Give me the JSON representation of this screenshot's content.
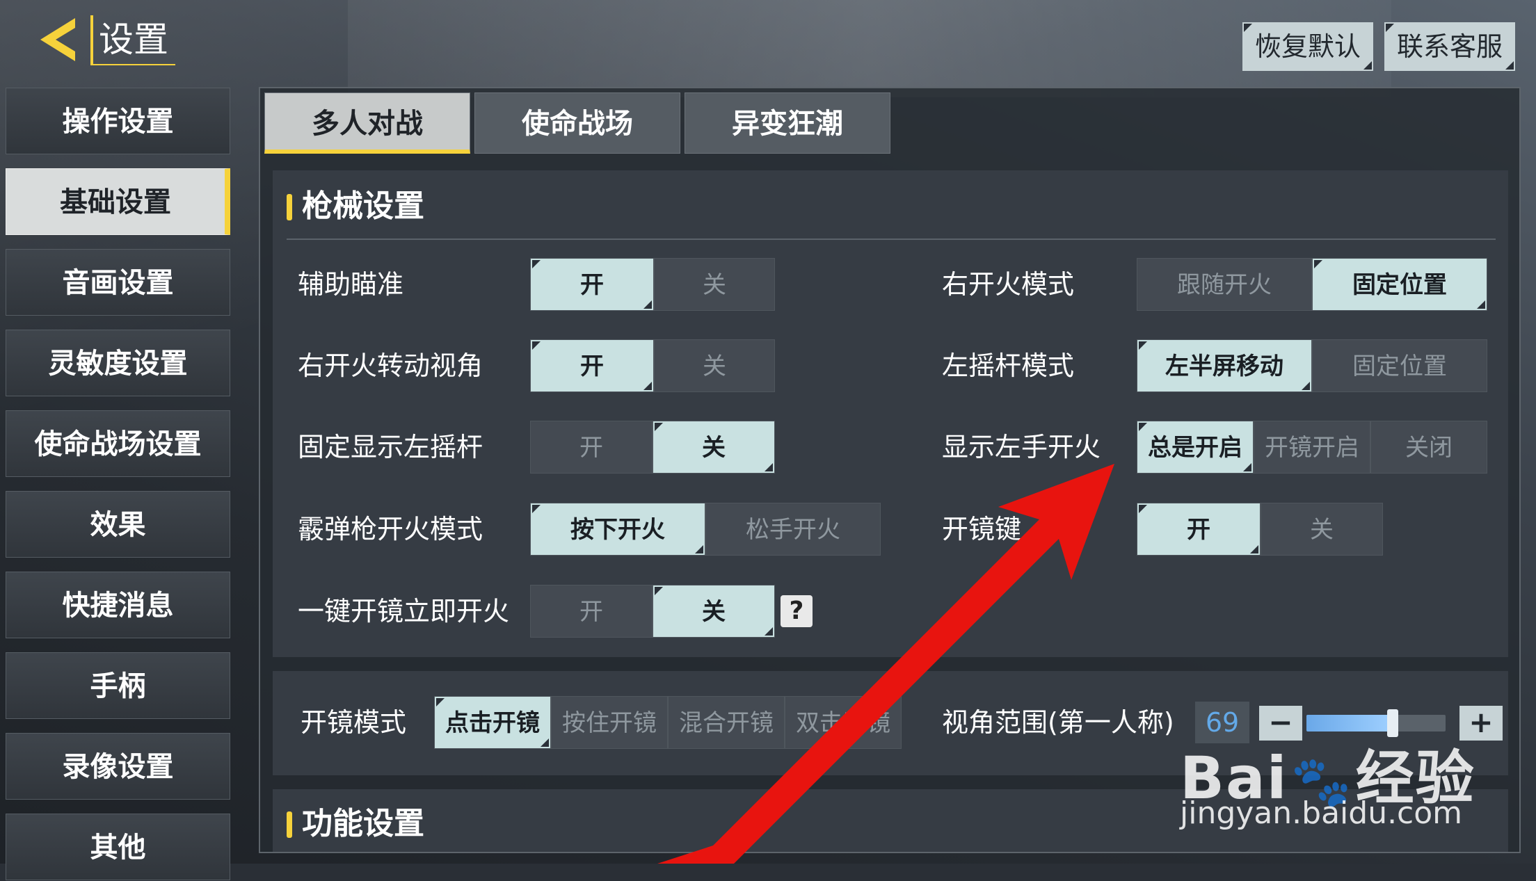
{
  "header": {
    "title": "设置",
    "restore_default": "恢复默认",
    "contact_service": "联系客服"
  },
  "sidebar": {
    "items": [
      {
        "label": "操作设置"
      },
      {
        "label": "基础设置"
      },
      {
        "label": "音画设置"
      },
      {
        "label": "灵敏度设置"
      },
      {
        "label": "使命战场设置"
      },
      {
        "label": "效果"
      },
      {
        "label": "快捷消息"
      },
      {
        "label": "手柄"
      },
      {
        "label": "录像设置"
      },
      {
        "label": "其他"
      }
    ],
    "active_index": 1
  },
  "tabs": [
    {
      "label": "多人对战"
    },
    {
      "label": "使命战场"
    },
    {
      "label": "异变狂潮"
    }
  ],
  "weapon": {
    "heading": "枪械设置",
    "aim_assist": {
      "label": "辅助瞄准",
      "on": "开",
      "off": "关"
    },
    "right_fire_rotate": {
      "label": "右开火转动视角",
      "on": "开",
      "off": "关"
    },
    "fixed_left_stick": {
      "label": "固定显示左摇杆",
      "on": "开",
      "off": "关"
    },
    "shotgun_fire": {
      "label": "霰弹枪开火模式",
      "press": "按下开火",
      "release": "松手开火"
    },
    "scope_fire": {
      "label": "一键开镜立即开火",
      "on": "开",
      "off": "关",
      "help": "?"
    },
    "right_fire_mode": {
      "label": "右开火模式",
      "follow": "跟随开火",
      "fixed": "固定位置"
    },
    "left_stick_mode": {
      "label": "左摇杆模式",
      "half": "左半屏移动",
      "fixed": "固定位置"
    },
    "left_hand_fire": {
      "label": "显示左手开火",
      "always": "总是开启",
      "scope": "开镜开启",
      "off": "关闭"
    },
    "scope_key": {
      "label": "开镜键",
      "on": "开",
      "off": "关"
    }
  },
  "scope_mode": {
    "label": "开镜模式",
    "options": [
      "点击开镜",
      "按住开镜",
      "混合开镜",
      "双击开镜"
    ]
  },
  "fov": {
    "label": "视角范围(第一人称)",
    "value": "69",
    "minus": "−",
    "plus": "+",
    "level": 0.62
  },
  "function": {
    "heading": "功能设置"
  },
  "watermark": {
    "brand": "Bai",
    "brand2": "经验",
    "url": "jingyan.baidu.com"
  },
  "colors": {
    "accent": "#f6d23b",
    "selected": "#c9e1e1",
    "arrow": "#e8140f"
  }
}
